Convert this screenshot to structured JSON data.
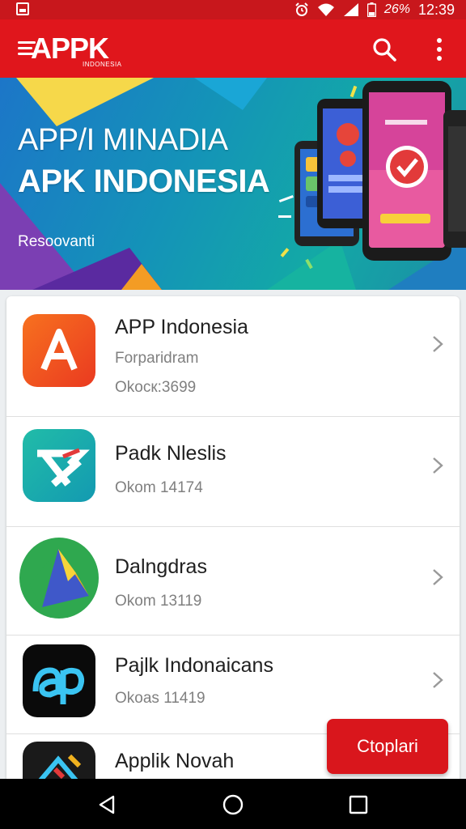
{
  "status_bar": {
    "battery": "26%",
    "time": "12:39"
  },
  "app_bar": {
    "logo_text": "APPK",
    "logo_subtext": "INDONESIA"
  },
  "banner": {
    "title_line1": "APP/I MINADIA",
    "title_line2": "APK INDONESIA",
    "tagline": "Resoovanti"
  },
  "apps": [
    {
      "name": "APP Indonesia",
      "category": "Forparidram",
      "meta": "Okocк:3699"
    },
    {
      "name": "Padk Nleslis",
      "category": "",
      "meta": "Okom 14174"
    },
    {
      "name": "Dalngdras",
      "category": "",
      "meta": "Okom 13119"
    },
    {
      "name": "Pajlk Indonaicans",
      "category": "",
      "meta": "Okoas 11419"
    },
    {
      "name": "Applik Novah",
      "category": "",
      "meta": ""
    }
  ],
  "fab": {
    "label": "Ctoplari"
  },
  "colors": {
    "primary": "#e0161c",
    "status_bar": "#c8171c",
    "background": "#eceff1"
  }
}
